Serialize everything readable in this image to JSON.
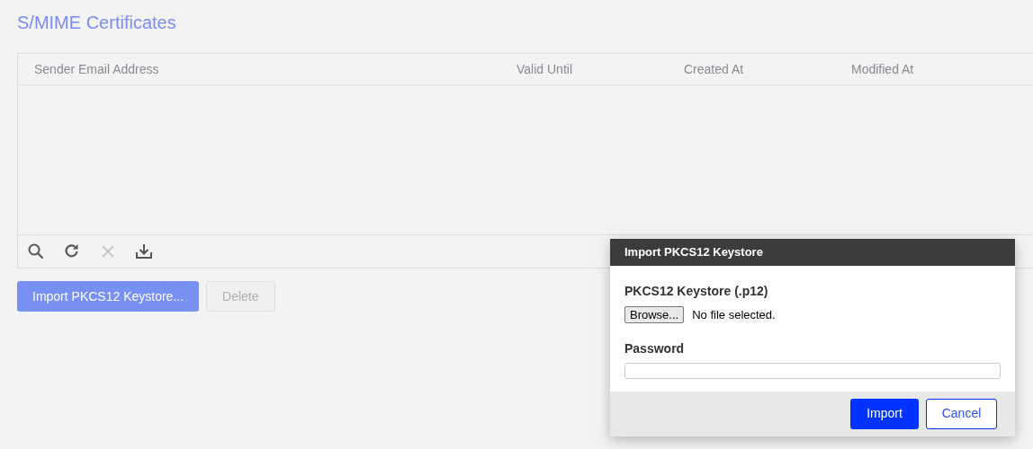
{
  "page_title": "S/MIME Certificates",
  "table": {
    "columns": [
      "Sender Email Address",
      "Valid Until",
      "Created At",
      "Modified At"
    ],
    "toolbar": [
      {
        "kind": "search",
        "disabled": false
      },
      {
        "kind": "refresh",
        "disabled": false
      },
      {
        "kind": "delete",
        "disabled": true
      },
      {
        "kind": "download",
        "disabled": false
      }
    ]
  },
  "buttons": [
    {
      "label": "Import PKCS12 Keystore...",
      "disabled": false
    },
    {
      "label": "Delete",
      "disabled": true
    }
  ],
  "dialog": {
    "title": "Import PKCS12 Keystore",
    "file_label": "PKCS12 Keystore (.p12)",
    "browse_button": "Browse...",
    "file_status": "No file selected.",
    "password_label": "Password",
    "buttons": [
      {
        "label": "Import",
        "primary": true
      },
      {
        "label": "Cancel",
        "primary": false
      }
    ]
  }
}
